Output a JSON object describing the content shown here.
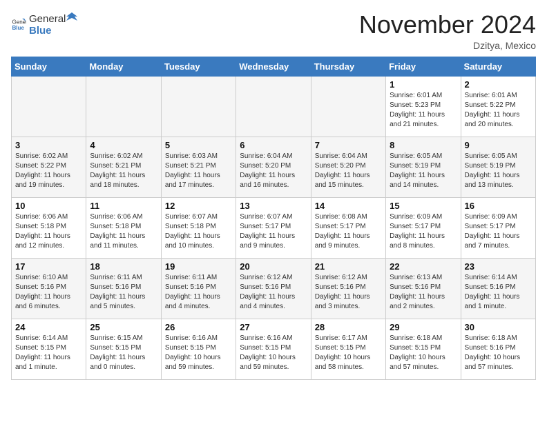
{
  "header": {
    "logo_general": "General",
    "logo_blue": "Blue",
    "month_title": "November 2024",
    "location": "Dzitya, Mexico"
  },
  "days_of_week": [
    "Sunday",
    "Monday",
    "Tuesday",
    "Wednesday",
    "Thursday",
    "Friday",
    "Saturday"
  ],
  "weeks": [
    [
      {
        "day": "",
        "info": ""
      },
      {
        "day": "",
        "info": ""
      },
      {
        "day": "",
        "info": ""
      },
      {
        "day": "",
        "info": ""
      },
      {
        "day": "",
        "info": ""
      },
      {
        "day": "1",
        "info": "Sunrise: 6:01 AM\nSunset: 5:23 PM\nDaylight: 11 hours\nand 21 minutes."
      },
      {
        "day": "2",
        "info": "Sunrise: 6:01 AM\nSunset: 5:22 PM\nDaylight: 11 hours\nand 20 minutes."
      }
    ],
    [
      {
        "day": "3",
        "info": "Sunrise: 6:02 AM\nSunset: 5:22 PM\nDaylight: 11 hours\nand 19 minutes."
      },
      {
        "day": "4",
        "info": "Sunrise: 6:02 AM\nSunset: 5:21 PM\nDaylight: 11 hours\nand 18 minutes."
      },
      {
        "day": "5",
        "info": "Sunrise: 6:03 AM\nSunset: 5:21 PM\nDaylight: 11 hours\nand 17 minutes."
      },
      {
        "day": "6",
        "info": "Sunrise: 6:04 AM\nSunset: 5:20 PM\nDaylight: 11 hours\nand 16 minutes."
      },
      {
        "day": "7",
        "info": "Sunrise: 6:04 AM\nSunset: 5:20 PM\nDaylight: 11 hours\nand 15 minutes."
      },
      {
        "day": "8",
        "info": "Sunrise: 6:05 AM\nSunset: 5:19 PM\nDaylight: 11 hours\nand 14 minutes."
      },
      {
        "day": "9",
        "info": "Sunrise: 6:05 AM\nSunset: 5:19 PM\nDaylight: 11 hours\nand 13 minutes."
      }
    ],
    [
      {
        "day": "10",
        "info": "Sunrise: 6:06 AM\nSunset: 5:18 PM\nDaylight: 11 hours\nand 12 minutes."
      },
      {
        "day": "11",
        "info": "Sunrise: 6:06 AM\nSunset: 5:18 PM\nDaylight: 11 hours\nand 11 minutes."
      },
      {
        "day": "12",
        "info": "Sunrise: 6:07 AM\nSunset: 5:18 PM\nDaylight: 11 hours\nand 10 minutes."
      },
      {
        "day": "13",
        "info": "Sunrise: 6:07 AM\nSunset: 5:17 PM\nDaylight: 11 hours\nand 9 minutes."
      },
      {
        "day": "14",
        "info": "Sunrise: 6:08 AM\nSunset: 5:17 PM\nDaylight: 11 hours\nand 9 minutes."
      },
      {
        "day": "15",
        "info": "Sunrise: 6:09 AM\nSunset: 5:17 PM\nDaylight: 11 hours\nand 8 minutes."
      },
      {
        "day": "16",
        "info": "Sunrise: 6:09 AM\nSunset: 5:17 PM\nDaylight: 11 hours\nand 7 minutes."
      }
    ],
    [
      {
        "day": "17",
        "info": "Sunrise: 6:10 AM\nSunset: 5:16 PM\nDaylight: 11 hours\nand 6 minutes."
      },
      {
        "day": "18",
        "info": "Sunrise: 6:11 AM\nSunset: 5:16 PM\nDaylight: 11 hours\nand 5 minutes."
      },
      {
        "day": "19",
        "info": "Sunrise: 6:11 AM\nSunset: 5:16 PM\nDaylight: 11 hours\nand 4 minutes."
      },
      {
        "day": "20",
        "info": "Sunrise: 6:12 AM\nSunset: 5:16 PM\nDaylight: 11 hours\nand 4 minutes."
      },
      {
        "day": "21",
        "info": "Sunrise: 6:12 AM\nSunset: 5:16 PM\nDaylight: 11 hours\nand 3 minutes."
      },
      {
        "day": "22",
        "info": "Sunrise: 6:13 AM\nSunset: 5:16 PM\nDaylight: 11 hours\nand 2 minutes."
      },
      {
        "day": "23",
        "info": "Sunrise: 6:14 AM\nSunset: 5:16 PM\nDaylight: 11 hours\nand 1 minute."
      }
    ],
    [
      {
        "day": "24",
        "info": "Sunrise: 6:14 AM\nSunset: 5:15 PM\nDaylight: 11 hours\nand 1 minute."
      },
      {
        "day": "25",
        "info": "Sunrise: 6:15 AM\nSunset: 5:15 PM\nDaylight: 11 hours\nand 0 minutes."
      },
      {
        "day": "26",
        "info": "Sunrise: 6:16 AM\nSunset: 5:15 PM\nDaylight: 10 hours\nand 59 minutes."
      },
      {
        "day": "27",
        "info": "Sunrise: 6:16 AM\nSunset: 5:15 PM\nDaylight: 10 hours\nand 59 minutes."
      },
      {
        "day": "28",
        "info": "Sunrise: 6:17 AM\nSunset: 5:15 PM\nDaylight: 10 hours\nand 58 minutes."
      },
      {
        "day": "29",
        "info": "Sunrise: 6:18 AM\nSunset: 5:15 PM\nDaylight: 10 hours\nand 57 minutes."
      },
      {
        "day": "30",
        "info": "Sunrise: 6:18 AM\nSunset: 5:16 PM\nDaylight: 10 hours\nand 57 minutes."
      }
    ]
  ]
}
